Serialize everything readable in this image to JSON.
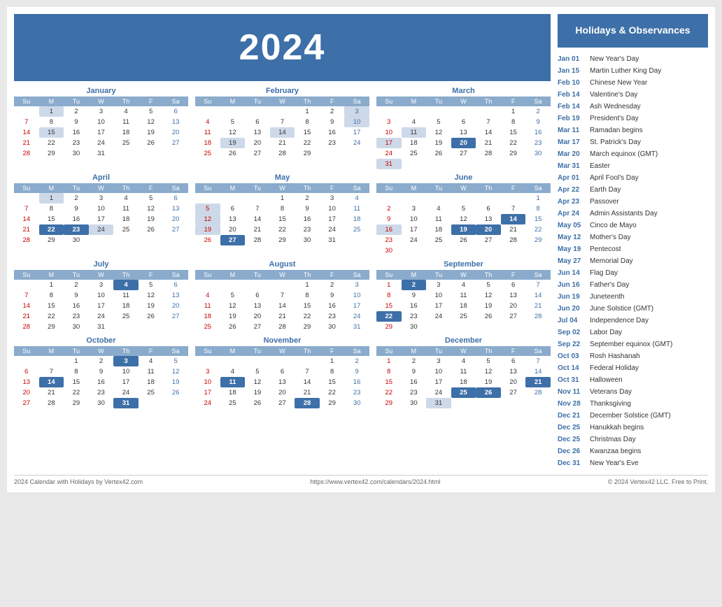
{
  "header": {
    "year": "2024",
    "background_color": "#3d6fa8"
  },
  "sidebar": {
    "title": "Holidays & Observances",
    "holidays": [
      {
        "date": "Jan 01",
        "name": "New Year's Day"
      },
      {
        "date": "Jan 15",
        "name": "Martin Luther King Day"
      },
      {
        "date": "Feb 10",
        "name": "Chinese New Year"
      },
      {
        "date": "Feb 14",
        "name": "Valentine's Day"
      },
      {
        "date": "Feb 14",
        "name": "Ash Wednesday"
      },
      {
        "date": "Feb 19",
        "name": "President's Day"
      },
      {
        "date": "Mar 11",
        "name": "Ramadan begins"
      },
      {
        "date": "Mar 17",
        "name": "St. Patrick's Day"
      },
      {
        "date": "Mar 20",
        "name": "March equinox (GMT)"
      },
      {
        "date": "Mar 31",
        "name": "Easter"
      },
      {
        "date": "Apr 01",
        "name": "April Fool's Day"
      },
      {
        "date": "Apr 22",
        "name": "Earth Day"
      },
      {
        "date": "Apr 23",
        "name": "Passover"
      },
      {
        "date": "Apr 24",
        "name": "Admin Assistants Day"
      },
      {
        "date": "May 05",
        "name": "Cinco de Mayo"
      },
      {
        "date": "May 12",
        "name": "Mother's Day"
      },
      {
        "date": "May 19",
        "name": "Pentecost"
      },
      {
        "date": "May 27",
        "name": "Memorial Day"
      },
      {
        "date": "Jun 14",
        "name": "Flag Day"
      },
      {
        "date": "Jun 16",
        "name": "Father's Day"
      },
      {
        "date": "Jun 19",
        "name": "Juneteenth"
      },
      {
        "date": "Jun 20",
        "name": "June Solstice (GMT)"
      },
      {
        "date": "Jul 04",
        "name": "Independence Day"
      },
      {
        "date": "Sep 02",
        "name": "Labor Day"
      },
      {
        "date": "Sep 22",
        "name": "September equinox (GMT)"
      },
      {
        "date": "Oct 03",
        "name": "Rosh Hashanah"
      },
      {
        "date": "Oct 14",
        "name": "Federal Holiday"
      },
      {
        "date": "Oct 31",
        "name": "Halloween"
      },
      {
        "date": "Nov 11",
        "name": "Veterans Day"
      },
      {
        "date": "Nov 28",
        "name": "Thanksgiving"
      },
      {
        "date": "Dec 21",
        "name": "December Solstice (GMT)"
      },
      {
        "date": "Dec 25",
        "name": "Hanukkah begins"
      },
      {
        "date": "Dec 25",
        "name": "Christmas Day"
      },
      {
        "date": "Dec 26",
        "name": "Kwanzaa begins"
      },
      {
        "date": "Dec 31",
        "name": "New Year's Eve"
      }
    ]
  },
  "footer": {
    "left": "2024 Calendar with Holidays by Vertex42.com",
    "center": "https://www.vertex42.com/calendars/2024.html",
    "right": "© 2024 Vertex42 LLC. Free to Print."
  },
  "months": [
    {
      "name": "January",
      "weeks": [
        [
          null,
          1,
          2,
          3,
          4,
          5,
          6
        ],
        [
          7,
          8,
          9,
          10,
          11,
          12,
          13
        ],
        [
          14,
          15,
          16,
          17,
          18,
          19,
          20
        ],
        [
          21,
          22,
          23,
          24,
          25,
          26,
          27
        ],
        [
          28,
          29,
          30,
          31,
          null,
          null,
          null
        ]
      ],
      "highlights": [
        1,
        15
      ],
      "dark_highlights": []
    },
    {
      "name": "February",
      "weeks": [
        [
          null,
          null,
          null,
          null,
          1,
          2,
          3
        ],
        [
          4,
          5,
          6,
          7,
          8,
          9,
          10
        ],
        [
          11,
          12,
          13,
          14,
          15,
          16,
          17
        ],
        [
          18,
          19,
          20,
          21,
          22,
          23,
          24
        ],
        [
          25,
          26,
          27,
          28,
          29,
          null,
          null
        ]
      ],
      "highlights": [
        3,
        10,
        14,
        19
      ],
      "dark_highlights": []
    },
    {
      "name": "March",
      "weeks": [
        [
          null,
          null,
          null,
          null,
          null,
          1,
          2
        ],
        [
          3,
          4,
          5,
          6,
          7,
          8,
          9
        ],
        [
          10,
          11,
          12,
          13,
          14,
          15,
          16
        ],
        [
          17,
          18,
          19,
          20,
          21,
          22,
          23
        ],
        [
          24,
          25,
          26,
          27,
          28,
          29,
          30
        ],
        [
          31,
          null,
          null,
          null,
          null,
          null,
          null
        ]
      ],
      "highlights": [
        11,
        17,
        20,
        31
      ],
      "dark_highlights": [
        20
      ]
    },
    {
      "name": "April",
      "weeks": [
        [
          null,
          1,
          2,
          3,
          4,
          5,
          6
        ],
        [
          7,
          8,
          9,
          10,
          11,
          12,
          13
        ],
        [
          14,
          15,
          16,
          17,
          18,
          19,
          20
        ],
        [
          21,
          22,
          23,
          24,
          25,
          26,
          27
        ],
        [
          28,
          29,
          30,
          null,
          null,
          null,
          null
        ]
      ],
      "highlights": [
        1,
        22,
        23,
        24
      ],
      "dark_highlights": [
        22,
        23
      ]
    },
    {
      "name": "May",
      "weeks": [
        [
          null,
          null,
          null,
          1,
          2,
          3,
          4
        ],
        [
          5,
          6,
          7,
          8,
          9,
          10,
          11
        ],
        [
          12,
          13,
          14,
          15,
          16,
          17,
          18
        ],
        [
          19,
          20,
          21,
          22,
          23,
          24,
          25
        ],
        [
          26,
          27,
          28,
          29,
          30,
          31,
          null
        ]
      ],
      "highlights": [
        5,
        12,
        19,
        27
      ],
      "dark_highlights": [
        27
      ]
    },
    {
      "name": "June",
      "weeks": [
        [
          null,
          null,
          null,
          null,
          null,
          null,
          1
        ],
        [
          2,
          3,
          4,
          5,
          6,
          7,
          8
        ],
        [
          9,
          10,
          11,
          12,
          13,
          14,
          15
        ],
        [
          16,
          17,
          18,
          19,
          20,
          21,
          22
        ],
        [
          23,
          24,
          25,
          26,
          27,
          28,
          29
        ],
        [
          30,
          null,
          null,
          null,
          null,
          null,
          null
        ]
      ],
      "highlights": [
        14,
        16,
        19,
        20
      ],
      "dark_highlights": [
        14,
        19,
        20
      ]
    },
    {
      "name": "July",
      "weeks": [
        [
          null,
          1,
          2,
          3,
          4,
          5,
          6
        ],
        [
          7,
          8,
          9,
          10,
          11,
          12,
          13
        ],
        [
          14,
          15,
          16,
          17,
          18,
          19,
          20
        ],
        [
          21,
          22,
          23,
          24,
          25,
          26,
          27
        ],
        [
          28,
          29,
          30,
          31,
          null,
          null,
          null
        ]
      ],
      "highlights": [
        4
      ],
      "dark_highlights": [
        4
      ]
    },
    {
      "name": "August",
      "weeks": [
        [
          null,
          null,
          null,
          null,
          1,
          2,
          3
        ],
        [
          4,
          5,
          6,
          7,
          8,
          9,
          10
        ],
        [
          11,
          12,
          13,
          14,
          15,
          16,
          17
        ],
        [
          18,
          19,
          20,
          21,
          22,
          23,
          24
        ],
        [
          25,
          26,
          27,
          28,
          29,
          30,
          31
        ]
      ],
      "highlights": [],
      "dark_highlights": []
    },
    {
      "name": "September",
      "weeks": [
        [
          1,
          2,
          3,
          4,
          5,
          6,
          7
        ],
        [
          8,
          9,
          10,
          11,
          12,
          13,
          14
        ],
        [
          15,
          16,
          17,
          18,
          19,
          20,
          21
        ],
        [
          22,
          23,
          24,
          25,
          26,
          27,
          28
        ],
        [
          29,
          30,
          null,
          null,
          null,
          null,
          null
        ]
      ],
      "highlights": [
        2,
        22
      ],
      "dark_highlights": [
        2,
        22
      ]
    },
    {
      "name": "October",
      "weeks": [
        [
          null,
          null,
          1,
          2,
          3,
          4,
          5
        ],
        [
          6,
          7,
          8,
          9,
          10,
          11,
          12
        ],
        [
          13,
          14,
          15,
          16,
          17,
          18,
          19
        ],
        [
          20,
          21,
          22,
          23,
          24,
          25,
          26
        ],
        [
          27,
          28,
          29,
          30,
          31,
          null,
          null
        ]
      ],
      "highlights": [
        3,
        14,
        31
      ],
      "dark_highlights": [
        3,
        14,
        31
      ]
    },
    {
      "name": "November",
      "weeks": [
        [
          null,
          null,
          null,
          null,
          null,
          1,
          2
        ],
        [
          3,
          4,
          5,
          6,
          7,
          8,
          9
        ],
        [
          10,
          11,
          12,
          13,
          14,
          15,
          16
        ],
        [
          17,
          18,
          19,
          20,
          21,
          22,
          23
        ],
        [
          24,
          25,
          26,
          27,
          28,
          29,
          30
        ]
      ],
      "highlights": [
        11,
        28
      ],
      "dark_highlights": [
        11,
        28
      ]
    },
    {
      "name": "December",
      "weeks": [
        [
          1,
          2,
          3,
          4,
          5,
          6,
          7
        ],
        [
          8,
          9,
          10,
          11,
          12,
          13,
          14
        ],
        [
          15,
          16,
          17,
          18,
          19,
          20,
          21
        ],
        [
          22,
          23,
          24,
          25,
          26,
          27,
          28
        ],
        [
          29,
          30,
          31,
          null,
          null,
          null,
          null
        ]
      ],
      "highlights": [
        21,
        25,
        26,
        31
      ],
      "dark_highlights": [
        21,
        25,
        26
      ]
    }
  ]
}
